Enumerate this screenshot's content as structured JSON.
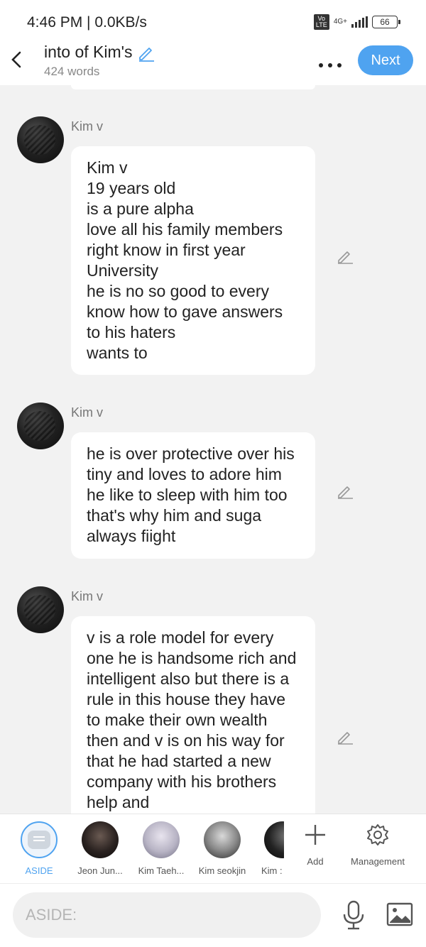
{
  "status_bar": {
    "time": "4:46 PM | 0.0KB/s",
    "network_badge": "Vo LTE",
    "network_type": "4G+",
    "battery": "66"
  },
  "header": {
    "back_icon": "chevron-left-icon",
    "title": "into of Kim's",
    "word_count": "424 words",
    "more_icon": "more-horizontal-icon",
    "next_label": "Next",
    "accent_color": "#4fa3f0"
  },
  "messages": [
    {
      "sender": "Kim v",
      "text": "Kim v\n19 years old\nis a pure alpha\nlove all his family members\nright know in first year University\nhe is no so good to every know how to gave answers to his haters\nwants to"
    },
    {
      "sender": "Kim v",
      "text": "he is over protective over his tiny and loves to adore him he like to sleep with him too that's why him and suga always fiight"
    },
    {
      "sender": "Kim v",
      "text": "v is a role model for every one he is handsome rich and intelligent also but there is a rule in this house they have to make their own wealth then and v is on his way for that he had started a new company with his brothers help and"
    }
  ],
  "characters": [
    {
      "label": "ASIDE"
    },
    {
      "label": "Jeon Jun..."
    },
    {
      "label": "Kim Taeh..."
    },
    {
      "label": "Kim seokjin"
    },
    {
      "label": "Kim :"
    }
  ],
  "actions": {
    "add_label": "Add",
    "management_label": "Management"
  },
  "input": {
    "placeholder": "ASIDE:",
    "mic_icon": "microphone-icon",
    "image_icon": "image-icon"
  }
}
